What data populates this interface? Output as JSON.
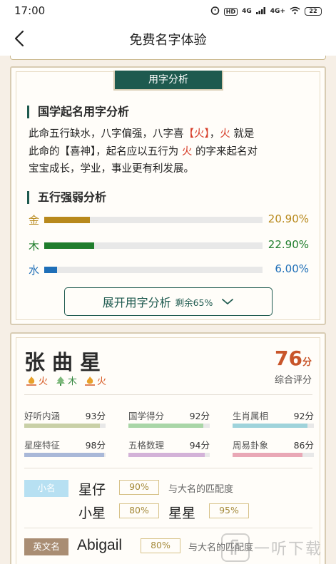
{
  "status_bar": {
    "time": "17:00",
    "hd_label": "HD",
    "network_1": "4G",
    "network_2": "4G+",
    "battery": "22"
  },
  "nav": {
    "title": "免费名字体验"
  },
  "analysis": {
    "tab_label": "用字分析",
    "guoxue_title": "国学起名用字分析",
    "para_line1_a": "此命五行缺水，八字偏强，八字喜",
    "para_line1_b": "【火】",
    "para_line1_c": "，",
    "para_line1_d": "火",
    "para_line1_e": "就是",
    "para_line2_a": "此命的【喜神】，起名应以五行为",
    "para_line2_b": "火",
    "para_line2_c": "的字来起名对",
    "para_line3": "宝宝成长，学业，事业更有利发展。",
    "wuxing_title": "五行强弱分析",
    "elements": [
      {
        "label": "金",
        "percent_text": "20.90%",
        "value": 20.9,
        "color": "#b8891c"
      },
      {
        "label": "木",
        "percent_text": "22.90%",
        "value": 22.9,
        "color": "#1f7d2c"
      },
      {
        "label": "水",
        "percent_text": "6.00%",
        "value": 6.0,
        "color": "#1f6fb8"
      }
    ],
    "expand_label": "展开用字分析",
    "expand_sub": "剩余65%"
  },
  "name_card": {
    "name": "张曲星",
    "chars_elements": [
      {
        "element": "火",
        "icon": "flame-icon",
        "color": "#d6561f"
      },
      {
        "element": "木",
        "icon": "tree-icon",
        "color": "#3a8a45"
      },
      {
        "element": "火",
        "icon": "flame-icon",
        "color": "#d6561f"
      }
    ],
    "score": "76",
    "score_unit": "分",
    "score_label": "综合评分",
    "metrics": [
      {
        "label": "好听内涵",
        "value": "93分",
        "score": 93,
        "color": "#c9d0a7"
      },
      {
        "label": "国学得分",
        "value": "92分",
        "score": 92,
        "color": "#a9d6a7"
      },
      {
        "label": "生肖属相",
        "value": "92分",
        "score": 92,
        "color": "#9fd3db"
      },
      {
        "label": "星座特征",
        "value": "98分",
        "score": 98,
        "color": "#a9b8d8"
      },
      {
        "label": "五格数理",
        "value": "94分",
        "score": 94,
        "color": "#d3b2d8"
      },
      {
        "label": "周易卦象",
        "value": "86分",
        "score": 86,
        "color": "#e9a8b6"
      }
    ],
    "nickname_badge": "小名",
    "nicknames": [
      {
        "name": "星仔",
        "match": "90%"
      },
      {
        "name": "小星",
        "match": "80%"
      },
      {
        "name": "星星",
        "match": "95%"
      }
    ],
    "match_text": "与大名的匹配度",
    "english_badge": "英文名",
    "english_names": [
      {
        "name": "Abigail",
        "match": "80%"
      }
    ],
    "english_match_text": "与大名的匹配度"
  },
  "watermark": {
    "text": "一听下载"
  }
}
